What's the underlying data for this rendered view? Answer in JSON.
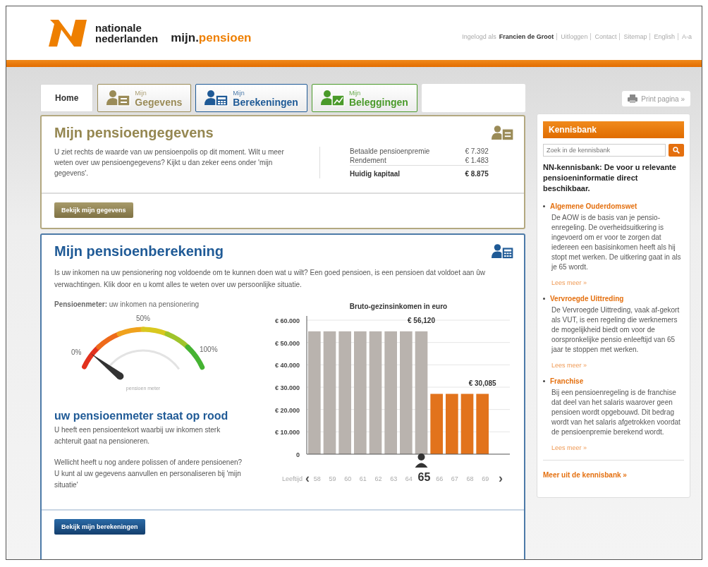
{
  "header": {
    "logo": {
      "line1": "nationale",
      "line2": "nederlanden",
      "product_start": "mijn.",
      "product_end": "pensioen"
    },
    "user_bar": {
      "logged_in_label": "Ingelogd als",
      "user_name": "Francien de Groot",
      "links": [
        "Uitloggen",
        "Contact",
        "Sitemap",
        "English",
        "A-a"
      ]
    }
  },
  "tabs": [
    {
      "kind": "plain",
      "label": "Home",
      "color": "#333333",
      "selected": true
    },
    {
      "kind": "card",
      "small": "Mijn",
      "label": "Gegevens",
      "color": "#9a8b57",
      "selected": false
    },
    {
      "kind": "calculator",
      "small": "Mijn",
      "label": "Berekeningen",
      "color": "#1f5a96",
      "selected": false
    },
    {
      "kind": "chart",
      "small": "Mijn",
      "label": "Beleggingen",
      "color": "#4a9a2a",
      "selected": false
    }
  ],
  "gegevens": {
    "title": "Mijn pensioengegevens",
    "text": "U ziet rechts de waarde van uw pensioenpolis op dit moment. Wilt u meer weten over uw pensioengegevens? Kijkt u dan zeker eens onder 'mijn gegevens'.",
    "rows": [
      {
        "label": "Betaalde pensioenpremie",
        "value": "€ 7.392",
        "total": false
      },
      {
        "label": "Rendement",
        "value": "€ 1.483",
        "total": false
      },
      {
        "label": "Huidig kapitaal",
        "value": "€ 8.875",
        "total": true
      }
    ],
    "button": "Bekijk mijn gegevens"
  },
  "berekening": {
    "title": "Mijn pensioenberekening",
    "intro": "Is uw inkomen na uw pensionering nog voldoende om te kunnen doen wat u wilt? Een goed pensioen, is een pensioen dat voldoet aan ûw verwachtingen. Klik door en u komt alles te weten over uw persoonlijke situatie.",
    "meter": {
      "caption": "**Pensioenmeter:** uw inkomen na pensionering",
      "label_low": "0%",
      "label_mid": "50%",
      "label_high": "100%",
      "inner_label": "pensioen meter"
    },
    "status_title": "uw pensioenmeter staat op rood",
    "status_text": "U heeft een pensioentekort waarbij uw inkomen sterk achteruit gaat na pensioneren.",
    "extra_text": "Wellicht heeft u nog andere polissen of andere pensioenen? U kunt al uw gegevens aanvullen en personaliseren bij 'mijn situatie'",
    "chart": {
      "prev": "‹",
      "next": "›",
      "current": "65",
      "chart_data": {
        "type": "bar",
        "title": "Bruto-gezinsinkomen in euro",
        "xlabel": "Leeftijd",
        "categories": [
          "58",
          "59",
          "60",
          "61",
          "62",
          "63",
          "64",
          "65",
          "66",
          "67",
          "68",
          "69"
        ],
        "grid": true,
        "series": [
          {
            "color": "#b9b3ae",
            "values": [
              55000,
              55000,
              55000,
              55000,
              55000,
              55000,
              55000,
              55000,
              null,
              null,
              null,
              null
            ]
          },
          {
            "color": "#e2731c",
            "values": [
              null,
              null,
              null,
              null,
              null,
              null,
              null,
              null,
              27000,
              27000,
              27000,
              27000
            ]
          }
        ],
        "ylim": [
          0,
          60000
        ],
        "yticks": [
          {
            "value": 0,
            "label": "0"
          },
          {
            "value": 10000,
            "label": "€ 10.000"
          },
          {
            "value": 20000,
            "label": "€ 20.000"
          },
          {
            "value": 30000,
            "label": "€ 30.000"
          },
          {
            "value": 40000,
            "label": "€ 40.000"
          },
          {
            "value": 50000,
            "label": "€ 50.000"
          },
          {
            "value": 60000,
            "label": "€ 60.000"
          }
        ],
        "annotations": [
          "€ 56,120",
          "€ 30,085"
        ]
      }
    },
    "button": "Bekijk mijn berekeningen"
  },
  "print_button": "Print pagina »",
  "kennisbank": {
    "title": "Kennisbank",
    "search_placeholder": "Zoek in de kennisbank",
    "intro": "NN-kennisbank: De voor u relevante pensioeninformatie direct beschikbaar.",
    "articles": [
      {
        "title": "Algemene Ouderdomswet",
        "text": "De AOW is de basis van je pensio-enregeling. De overheidsuitkering is ingevoerd om er voor te zorgen dat iedereen een basisinkomen heeft als hij stopt met werken. De uitkering gaat in als je 65 wordt.",
        "link": "Lees meer »"
      },
      {
        "title": "Vervroegde Uittreding",
        "text": "De Vervroegde Uittreding, vaak af-gekort als VUT, is een regeling die werknemers de mogelijkheid biedt om voor de oorspronkelijke pensio enleeftijd van 65 jaar te stoppen met werken.",
        "link": "Lees meer »"
      },
      {
        "title": "Franchise",
        "text": "Bij een pensioenregeling is de franchise dat deel van het salaris waarover geen pensioen wordt opgebouwd. Dit bedrag wordt van het salaris afgetrokken voordat de pensioenpremie berekend wordt.",
        "link": "Lees meer »"
      }
    ],
    "more_link": "Meer uit de kennisbank »"
  }
}
